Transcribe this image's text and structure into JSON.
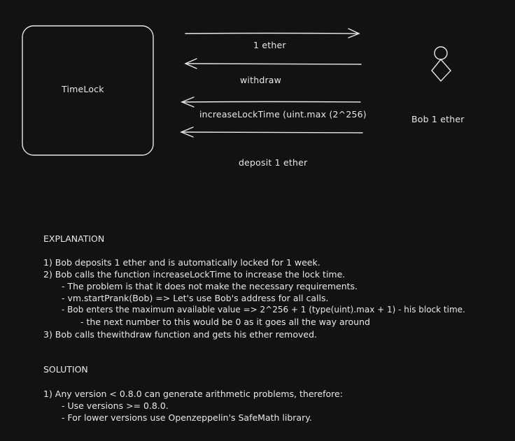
{
  "diagram": {
    "box_label": "TimeLock",
    "actor_label": "Bob 1 ether",
    "arrows": [
      {
        "label": "1 ether",
        "direction": "right"
      },
      {
        "label": "withdraw",
        "direction": "left"
      },
      {
        "label": "increaseLockTime (uint.max (2^256)",
        "direction": "left"
      },
      {
        "label": "deposit 1 ether",
        "direction": "left"
      }
    ]
  },
  "explanation": {
    "heading": "EXPLANATION",
    "lines": [
      "1) Bob deposits 1 ether and is automatically locked for 1 week.",
      "2) Bob calls the function increaseLockTime to increase the lock time.",
      "- The problem is that it does not make the necessary requirements.",
      "- vm.startPrank(Bob) => Let's use Bob's address for all calls.",
      "- Bob enters the maximum available value => 2^256 + 1 (type(uint).max + 1) - his block time.",
      "- the next number to this would be 0 as it goes all the way around",
      "3) Bob calls thewithdraw function and gets his ether removed."
    ]
  },
  "solution": {
    "heading": "SOLUTION",
    "lines": [
      "1) Any version < 0.8.0 can generate arithmetic problems, therefore:",
      "- Use versions >= 0.8.0.",
      "- For lower versions use Openzeppelin's SafeMath library."
    ]
  },
  "colors": {
    "background": "#121212",
    "stroke": "#e8e8e8"
  }
}
